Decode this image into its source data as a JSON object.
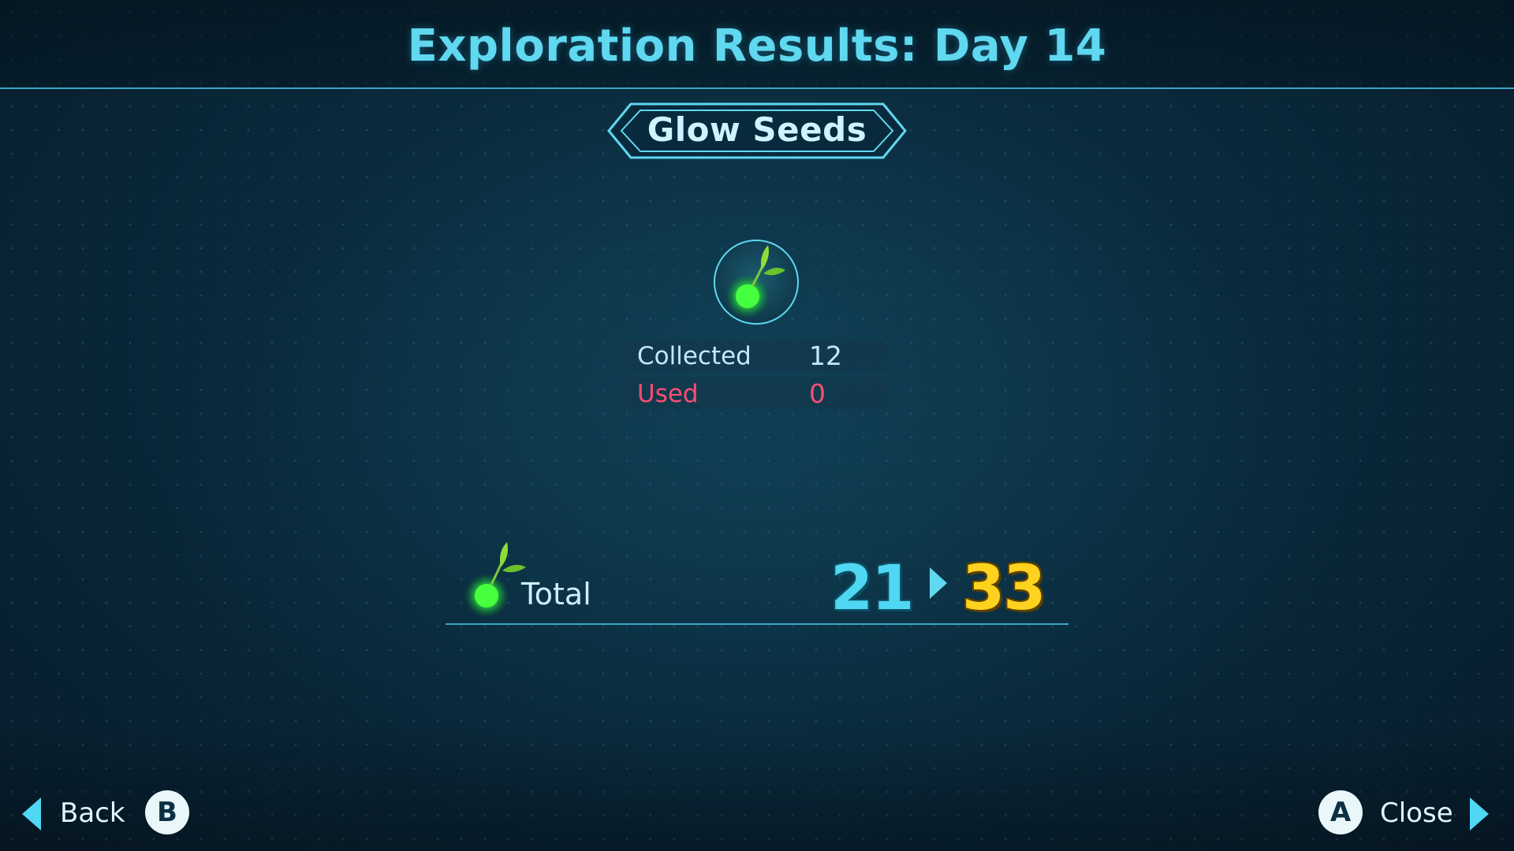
{
  "header": {
    "title": "Exploration Results: Day 14"
  },
  "category": {
    "label": "Glow Seeds"
  },
  "item": {
    "icon": "glow-seed-icon",
    "stats": {
      "collected_label": "Collected",
      "collected_value": "12",
      "used_label": "Used",
      "used_value": "0"
    }
  },
  "total": {
    "label": "Total",
    "previous": "21",
    "current": "33"
  },
  "footer": {
    "back_label": "Back",
    "back_button": "B",
    "close_label": "Close",
    "close_button": "A"
  },
  "colors": {
    "accent": "#5fd8f0",
    "highlight": "#ffd21f",
    "used": "#ff4d72",
    "seed_glow": "#39ff4a"
  }
}
